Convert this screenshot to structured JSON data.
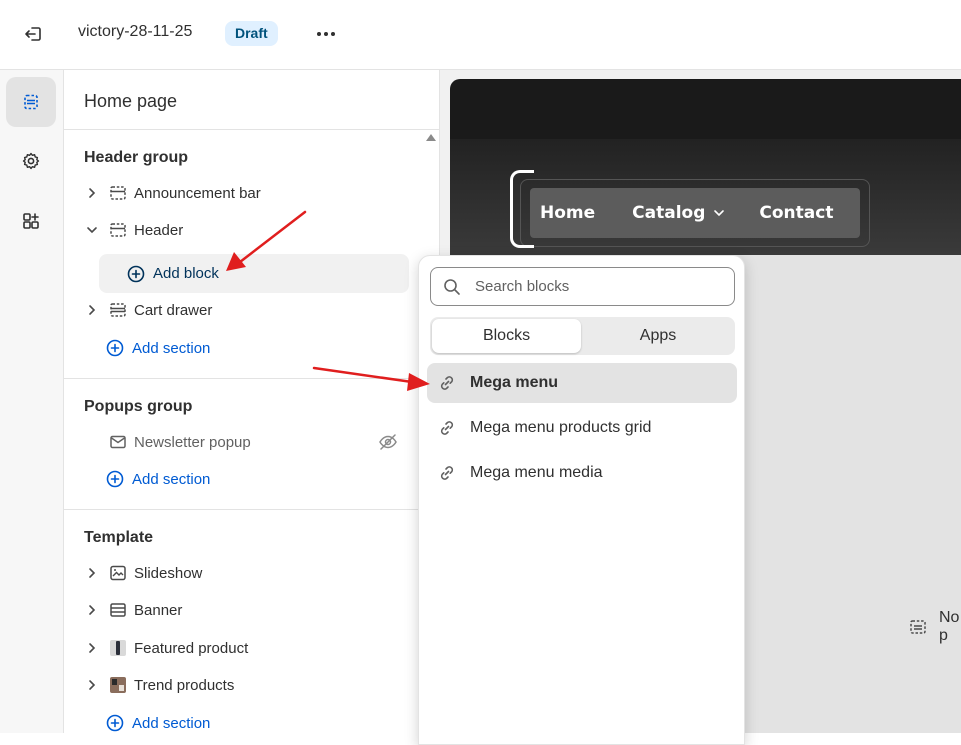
{
  "topbar": {
    "theme_name": "victory-28-11-25",
    "status_badge": "Draft",
    "exit_icon": "exit-icon",
    "more_icon": "more-horizontal-icon"
  },
  "rail": {
    "items": [
      {
        "icon": "sections-icon",
        "active": true
      },
      {
        "icon": "settings-gear-icon",
        "active": false
      },
      {
        "icon": "apps-icon",
        "active": false
      }
    ]
  },
  "panel": {
    "title": "Home page",
    "header_group": {
      "title": "Header group",
      "items": [
        "Announcement bar",
        "Header",
        "Cart drawer"
      ],
      "add_block": "Add block",
      "add_section": "Add section"
    },
    "popups_group": {
      "title": "Popups group",
      "items": [
        "Newsletter popup"
      ],
      "add_section": "Add section"
    },
    "template": {
      "title": "Template",
      "items": [
        "Slideshow",
        "Banner",
        "Featured product",
        "Trend products"
      ],
      "add_section": "Add section"
    }
  },
  "preview": {
    "nav": [
      "Home",
      "Catalog",
      "Contact"
    ],
    "placeholder": "No p"
  },
  "popover": {
    "search_placeholder": "Search blocks",
    "tabs": [
      "Blocks",
      "Apps"
    ],
    "active_tab": "Blocks",
    "blocks": [
      "Mega menu",
      "Mega menu products grid",
      "Mega menu media"
    ]
  },
  "colors": {
    "accent_blue": "#005bd3",
    "annotation_arrow": "#e01e1e",
    "badge_bg": "#e0f0ff"
  }
}
